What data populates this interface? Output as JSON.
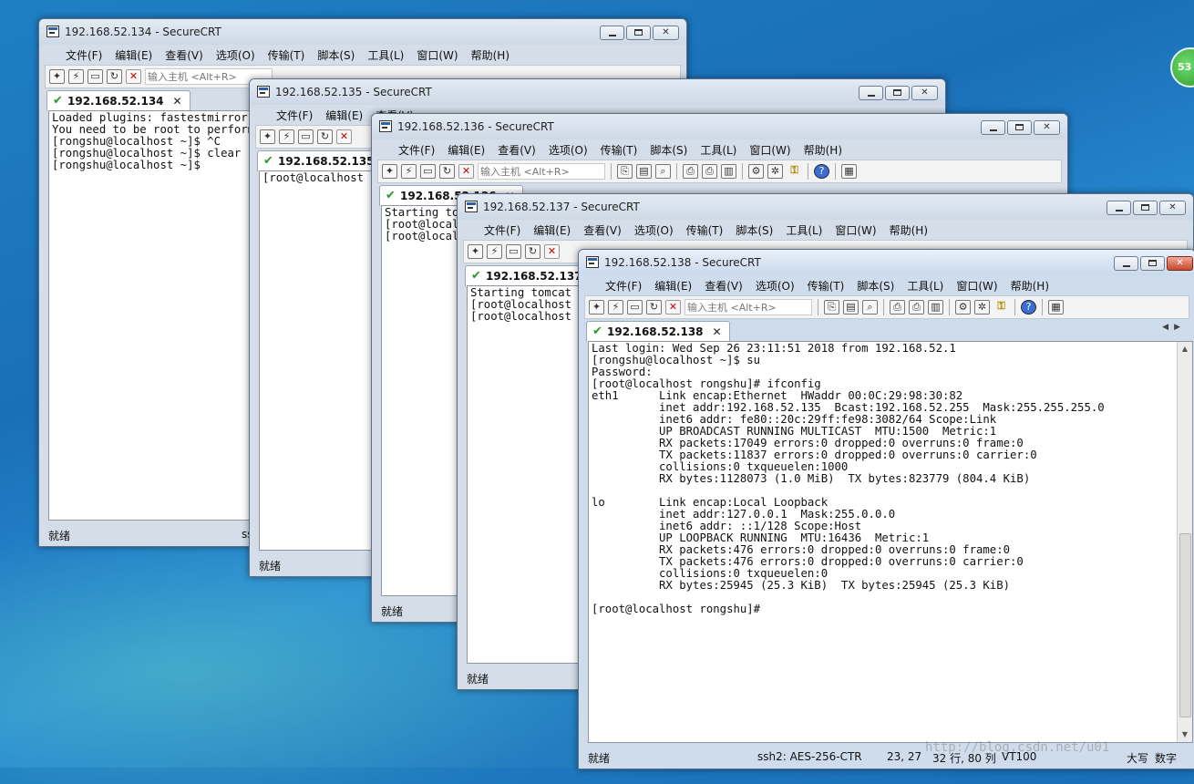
{
  "desktop": {
    "badge_text": "53"
  },
  "menu_labels": [
    "文件(F)",
    "编辑(E)",
    "查看(V)",
    "选项(O)",
    "传输(T)",
    "脚本(S)",
    "工具(L)",
    "窗口(W)",
    "帮助(H)"
  ],
  "host_placeholder": "输入主机 <Alt+R>",
  "status_ready": "就绪",
  "windows": [
    {
      "title": "192.168.52.134 - SecureCRT",
      "tab": "192.168.52.134",
      "terminal": "Loaded plugins: fastestmirror\nYou need to be root to perform this command.\n[rongshu@localhost ~]$ ^C\n[rongshu@localhost ~]$ clear\n[rongshu@localhost ~]$",
      "status_partial": "ss"
    },
    {
      "title": "192.168.52.135 - SecureCRT",
      "tab": "192.168.52.135",
      "terminal": "[root@localhost rongshu]#"
    },
    {
      "title": "192.168.52.136 - SecureCRT",
      "tab": "192.168.52.136",
      "terminal": "Starting tomcat\n[root@localhost rongshu]#\n[root@localhost rongshu]#"
    },
    {
      "title": "192.168.52.137 - SecureCRT",
      "tab": "192.168.52.137",
      "terminal": "Starting tomcat\n[root@localhost rongshu]#\n[root@localhost rongshu]#"
    },
    {
      "title": "192.168.52.138 - SecureCRT",
      "tab": "192.168.52.138",
      "terminal": "Last login: Wed Sep 26 23:11:51 2018 from 192.168.52.1\n[rongshu@localhost ~]$ su\nPassword:\n[root@localhost rongshu]# ifconfig\neth1      Link encap:Ethernet  HWaddr 00:0C:29:98:30:82\n          inet addr:192.168.52.135  Bcast:192.168.52.255  Mask:255.255.255.0\n          inet6 addr: fe80::20c:29ff:fe98:3082/64 Scope:Link\n          UP BROADCAST RUNNING MULTICAST  MTU:1500  Metric:1\n          RX packets:17049 errors:0 dropped:0 overruns:0 frame:0\n          TX packets:11837 errors:0 dropped:0 overruns:0 carrier:0\n          collisions:0 txqueuelen:1000\n          RX bytes:1128073 (1.0 MiB)  TX bytes:823779 (804.4 KiB)\n\nlo        Link encap:Local Loopback\n          inet addr:127.0.0.1  Mask:255.0.0.0\n          inet6 addr: ::1/128 Scope:Host\n          UP LOOPBACK RUNNING  MTU:16436  Metric:1\n          RX packets:476 errors:0 dropped:0 overruns:0 frame:0\n          TX packets:476 errors:0 dropped:0 overruns:0 carrier:0\n          collisions:0 txqueuelen:0\n          RX bytes:25945 (25.3 KiB)  TX bytes:25945 (25.3 KiB)\n\n[root@localhost rongshu]#",
      "status": {
        "ssh": "ssh2: AES-256-CTR",
        "cursor": "23,  27",
        "size": "32 行, 80 列",
        "term": "VT100",
        "caps": "大写",
        "num": "数字"
      }
    }
  ],
  "watermark": "http://blog.csdn.net/u01"
}
